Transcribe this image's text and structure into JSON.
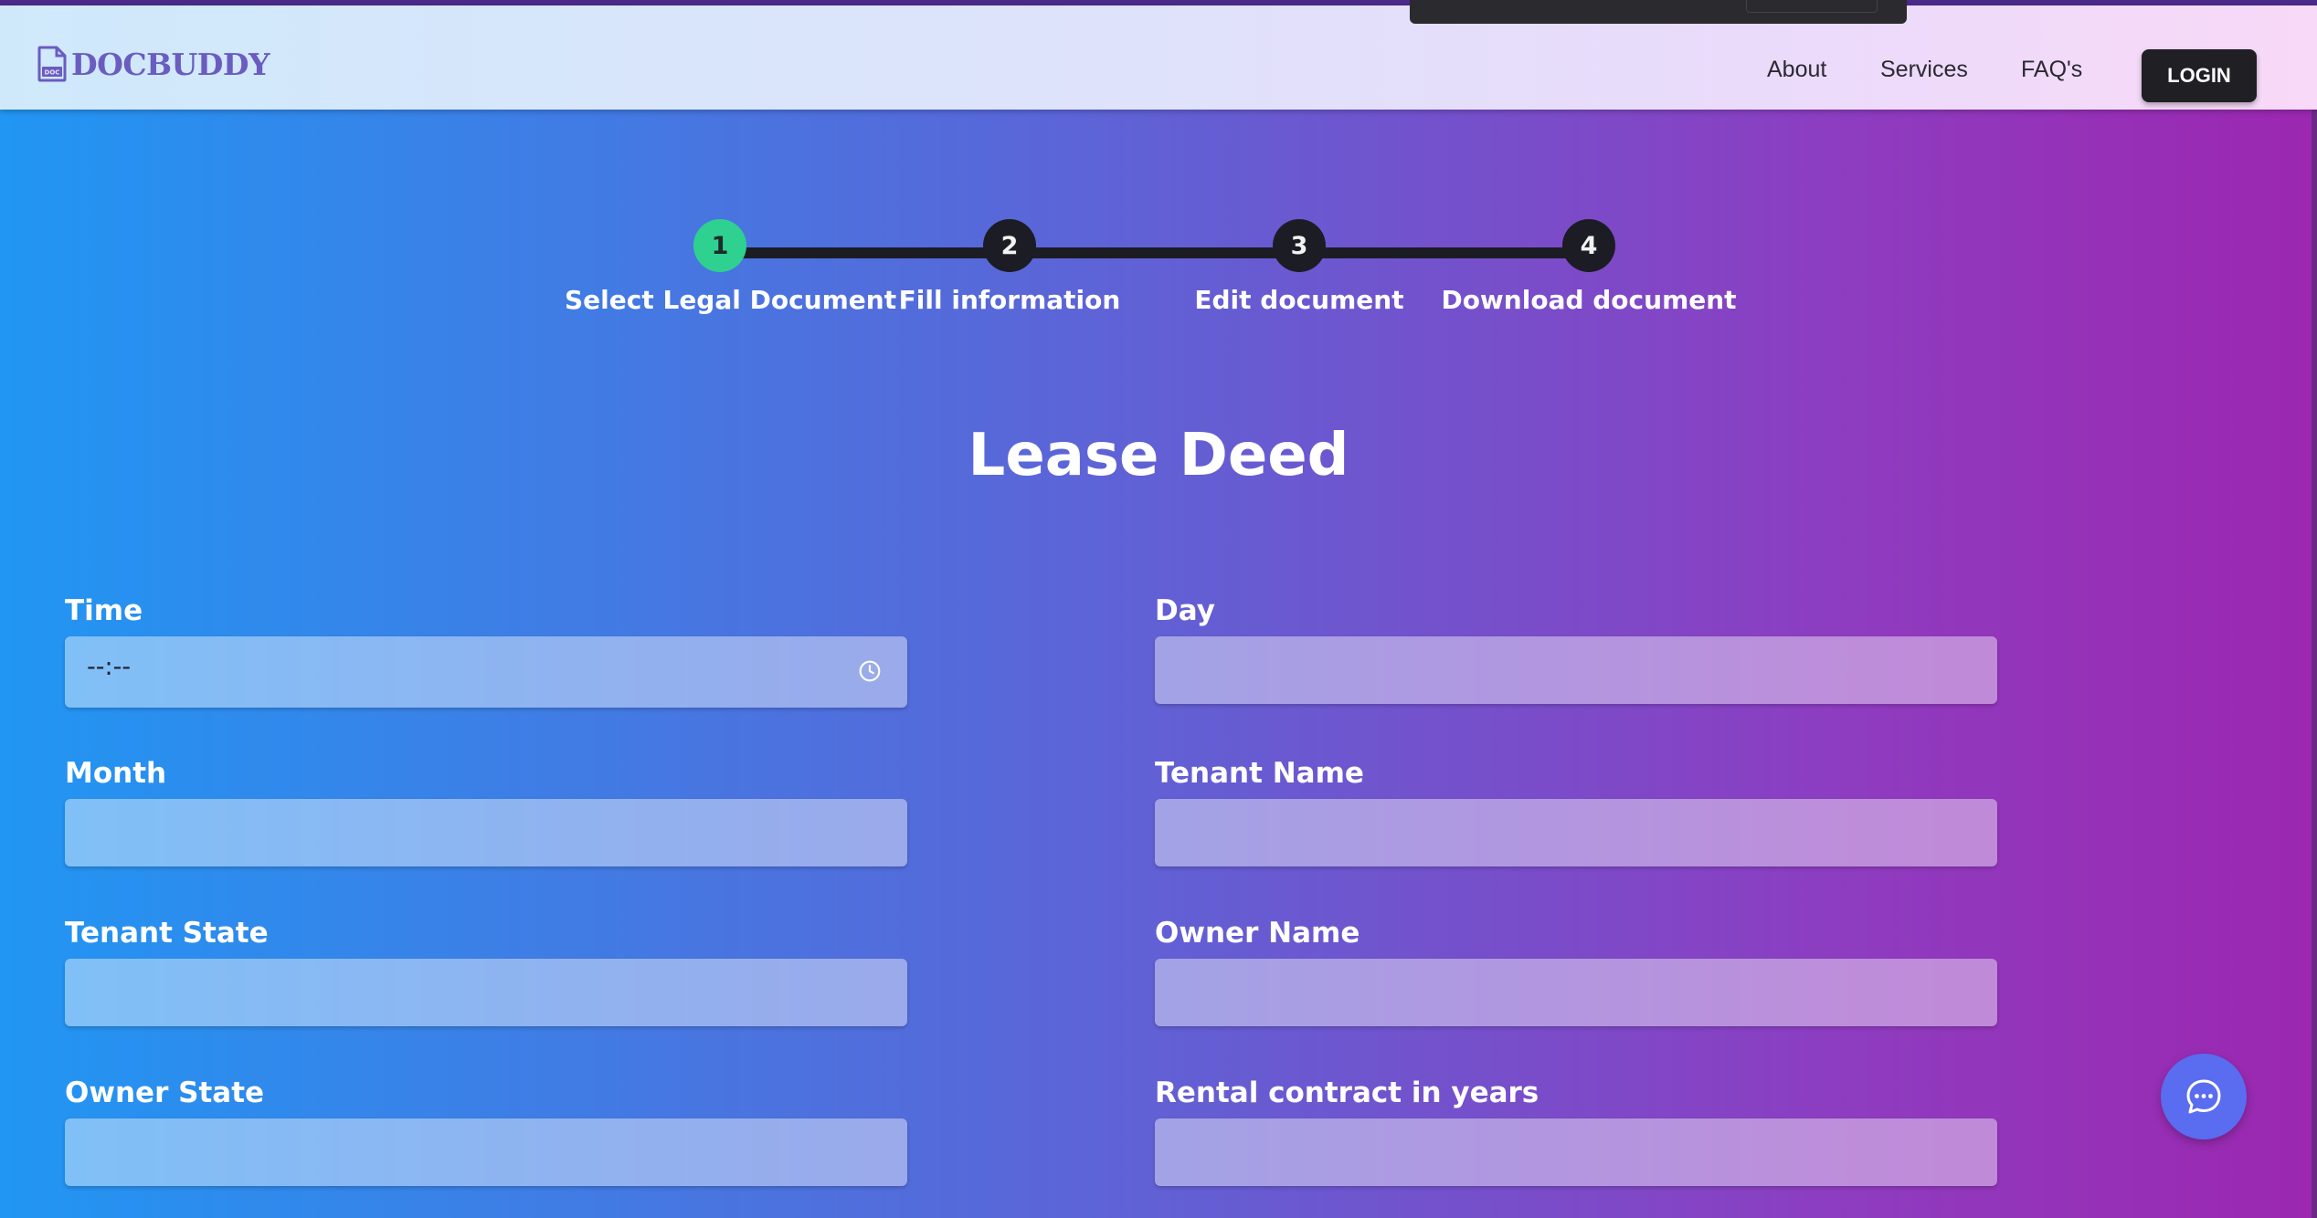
{
  "brand": {
    "name": "DOCBUDDY",
    "logo_icon": "document-icon",
    "logo_badge": "DOC"
  },
  "nav": {
    "links": [
      "About",
      "Services",
      "FAQ's"
    ],
    "login_label": "LOGIN"
  },
  "stepper": {
    "active_step": 1,
    "steps": [
      {
        "number": "1",
        "label": "Select Legal Document"
      },
      {
        "number": "2",
        "label": "Fill information"
      },
      {
        "number": "3",
        "label": "Edit document"
      },
      {
        "number": "4",
        "label": "Download document"
      }
    ]
  },
  "form": {
    "title": "Lease Deed",
    "time_field": {
      "label": "Time",
      "value": "--:--",
      "icon": "clock-icon"
    },
    "fields": [
      {
        "label": "Day",
        "value": ""
      },
      {
        "label": "Month",
        "value": ""
      },
      {
        "label": "Tenant Name",
        "value": ""
      },
      {
        "label": "Tenant State",
        "value": ""
      },
      {
        "label": "Owner Name",
        "value": ""
      },
      {
        "label": "Owner State",
        "value": ""
      },
      {
        "label": "Rental contract in years",
        "value": ""
      }
    ]
  },
  "chat": {
    "icon": "chat-bubble-icon"
  },
  "colors": {
    "accent_step": "#2ed18f",
    "login_bg": "#1f1f24",
    "chat_bg": "#5a6cf0",
    "brand_text": "#6a5cc0"
  }
}
